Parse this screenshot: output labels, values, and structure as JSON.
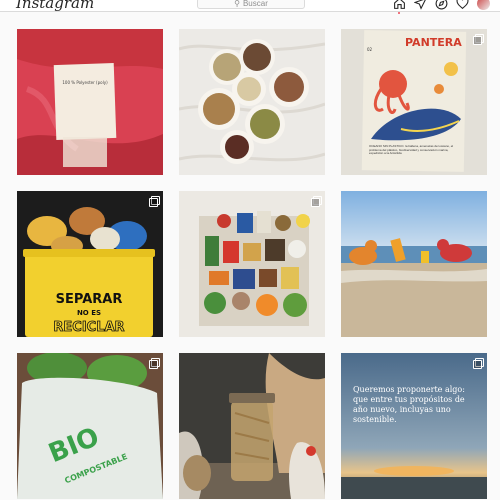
{
  "app": {
    "logo_text": "Instagram"
  },
  "search": {
    "placeholder": "Buscar"
  },
  "nav": {
    "badge_count": ""
  },
  "posts": {
    "p1": {
      "label_text": "100 % Polyester (poly)"
    },
    "p2": {},
    "p3": {
      "magazine_title": "PANTERA",
      "headline": "OCÉANO SIN PLÁSTICO. la ballena, amenazas del océano, el problema del plástico, biodiversidad y conservación marina, expedición a la Antártida",
      "issue": "02"
    },
    "p4": {
      "line1": "SEPARAR",
      "line2": "NO ES",
      "line3": "RECICLAR"
    },
    "p5": {},
    "p6": {},
    "p7": {
      "bag_text_1": "BIO",
      "bag_text_2": "COMPOSTABLE"
    },
    "p8": {},
    "p9": {
      "quote": "Queremos proponerte algo: que entre tus propósitos de año nuevo, incluyas uno sostenible."
    }
  }
}
